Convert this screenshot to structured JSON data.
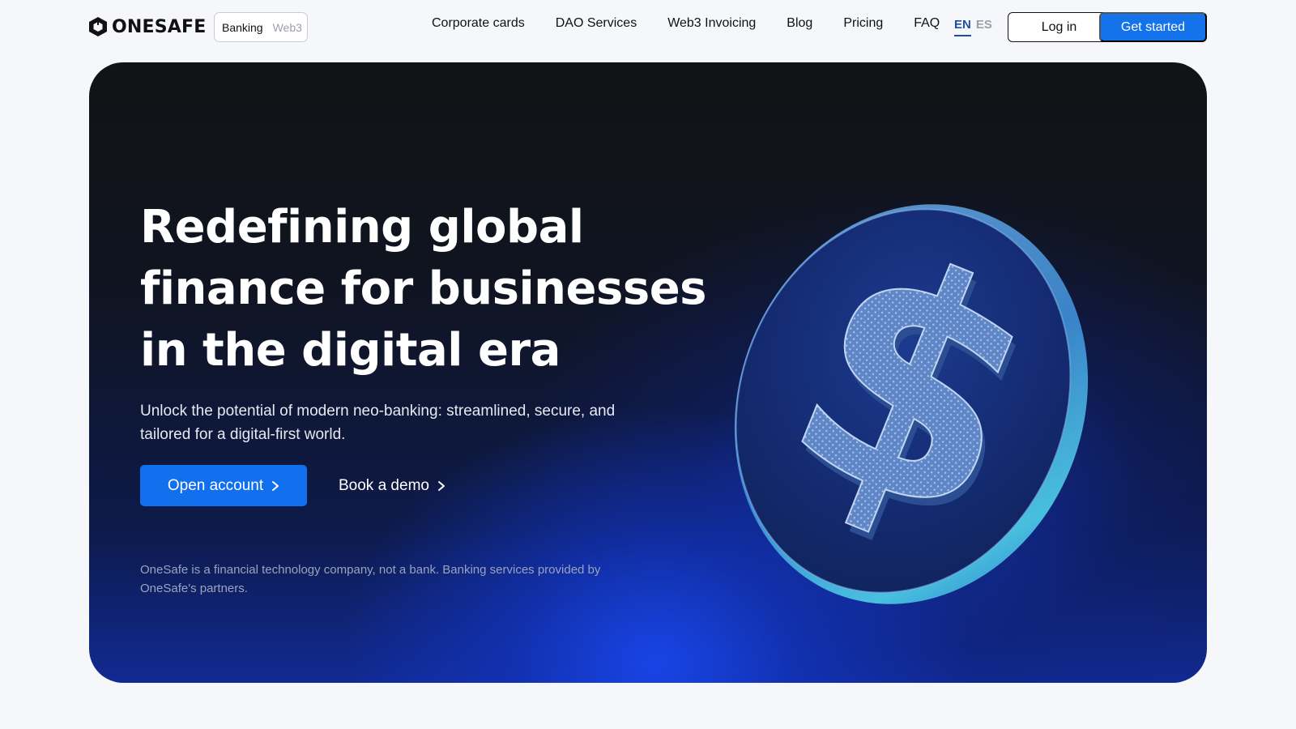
{
  "brand": {
    "name": "ONESAFE"
  },
  "mode_toggle": {
    "active": "Banking",
    "inactive": "Web3"
  },
  "nav": [
    {
      "label": "Corporate cards"
    },
    {
      "label": "DAO Services"
    },
    {
      "label": "Web3 Invoicing"
    },
    {
      "label": "Blog"
    },
    {
      "label": "Pricing"
    },
    {
      "label": "FAQ"
    }
  ],
  "language": {
    "active": "EN",
    "inactive": "ES"
  },
  "header_actions": {
    "login": "Log in",
    "get_started": "Get started"
  },
  "hero": {
    "title": "Redefining global finance for businesses in the digital era",
    "subtitle": "Unlock the potential of modern neo-banking: streamlined, secure, and tailored for a digital-first world.",
    "primary_cta": "Open account",
    "secondary_cta": "Book a demo",
    "disclaimer": "OneSafe is a financial technology company, not a bank. Banking services provided by OneSafe's partners."
  },
  "icons": {
    "logo": "onesafe-logo-icon",
    "cta_chevron": "chevron-right-icon",
    "hero_image": "dollar-coin-icon"
  },
  "colors": {
    "accent": "#1472ea",
    "hero_dark": "#121315",
    "hero_blue": "#1946eb",
    "lang_active": "#1b4fa8"
  }
}
